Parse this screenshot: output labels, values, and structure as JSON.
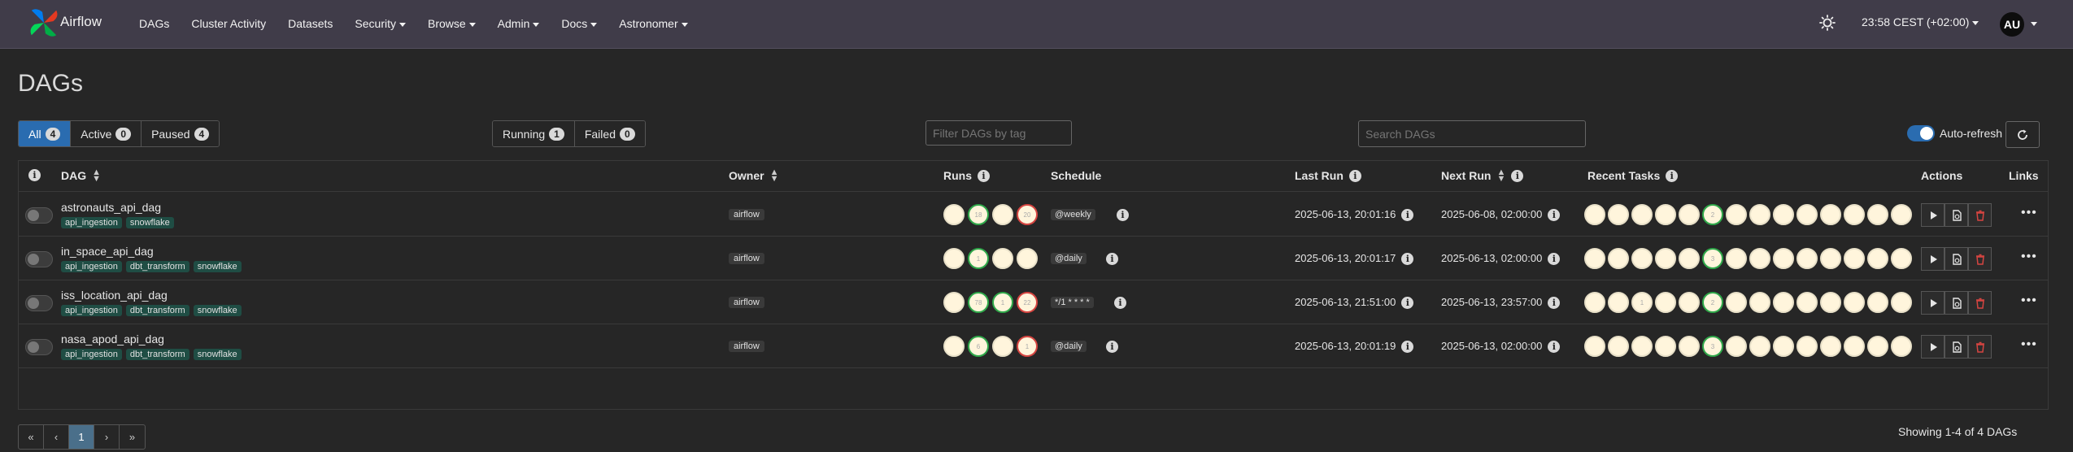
{
  "nav": {
    "brand": "Airflow",
    "items": [
      {
        "label": "DAGs",
        "dropdown": false
      },
      {
        "label": "Cluster Activity",
        "dropdown": false
      },
      {
        "label": "Datasets",
        "dropdown": false
      },
      {
        "label": "Security",
        "dropdown": true
      },
      {
        "label": "Browse",
        "dropdown": true
      },
      {
        "label": "Admin",
        "dropdown": true
      },
      {
        "label": "Docs",
        "dropdown": true
      },
      {
        "label": "Astronomer",
        "dropdown": true
      }
    ],
    "clock": "23:58 CEST (+02:00)",
    "avatar": "AU"
  },
  "page_title": "DAGs",
  "filters": {
    "status_tabs": [
      {
        "label": "All",
        "count": "4",
        "active": true
      },
      {
        "label": "Active",
        "count": "0",
        "active": false
      },
      {
        "label": "Paused",
        "count": "4",
        "active": false
      }
    ],
    "run_tabs": [
      {
        "label": "Running",
        "count": "1"
      },
      {
        "label": "Failed",
        "count": "0"
      }
    ],
    "tag_filter_placeholder": "Filter DAGs by tag",
    "search_placeholder": "Search DAGs",
    "auto_refresh_label": "Auto-refresh",
    "auto_refresh_on": true
  },
  "table": {
    "headers": {
      "dag": "DAG",
      "owner": "Owner",
      "runs": "Runs",
      "schedule": "Schedule",
      "last_run": "Last Run",
      "next_run": "Next Run",
      "recent_tasks": "Recent Tasks",
      "actions": "Actions",
      "links": "Links"
    },
    "rows": [
      {
        "name": "astronauts_api_dag",
        "tags": [
          "api_ingestion",
          "snowflake"
        ],
        "owner": "airflow",
        "runs": [
          {
            "count": "",
            "state": "none"
          },
          {
            "count": "18",
            "state": "success"
          },
          {
            "count": "",
            "state": "none"
          },
          {
            "count": "20",
            "state": "failed"
          }
        ],
        "schedule": "@weekly",
        "last_run": "2025-06-13, 20:01:16",
        "next_run": "2025-06-08, 02:00:00",
        "recent_tasks": [
          {
            "count": "",
            "state": "none"
          },
          {
            "count": "",
            "state": "none"
          },
          {
            "count": "",
            "state": "none"
          },
          {
            "count": "",
            "state": "none"
          },
          {
            "count": "",
            "state": "none"
          },
          {
            "count": "2",
            "state": "success"
          },
          {
            "count": "",
            "state": "none"
          },
          {
            "count": "",
            "state": "none"
          },
          {
            "count": "",
            "state": "none"
          },
          {
            "count": "",
            "state": "none"
          },
          {
            "count": "",
            "state": "none"
          },
          {
            "count": "",
            "state": "none"
          },
          {
            "count": "",
            "state": "none"
          },
          {
            "count": "",
            "state": "none"
          }
        ]
      },
      {
        "name": "in_space_api_dag",
        "tags": [
          "api_ingestion",
          "dbt_transform",
          "snowflake"
        ],
        "owner": "airflow",
        "runs": [
          {
            "count": "",
            "state": "none"
          },
          {
            "count": "1",
            "state": "success"
          },
          {
            "count": "",
            "state": "none"
          },
          {
            "count": "",
            "state": "none"
          }
        ],
        "schedule": "@daily",
        "last_run": "2025-06-13, 20:01:17",
        "next_run": "2025-06-13, 02:00:00",
        "recent_tasks": [
          {
            "count": "",
            "state": "none"
          },
          {
            "count": "",
            "state": "none"
          },
          {
            "count": "",
            "state": "none"
          },
          {
            "count": "",
            "state": "none"
          },
          {
            "count": "",
            "state": "none"
          },
          {
            "count": "3",
            "state": "success"
          },
          {
            "count": "",
            "state": "none"
          },
          {
            "count": "",
            "state": "none"
          },
          {
            "count": "",
            "state": "none"
          },
          {
            "count": "",
            "state": "none"
          },
          {
            "count": "",
            "state": "none"
          },
          {
            "count": "",
            "state": "none"
          },
          {
            "count": "",
            "state": "none"
          },
          {
            "count": "",
            "state": "none"
          }
        ]
      },
      {
        "name": "iss_location_api_dag",
        "tags": [
          "api_ingestion",
          "dbt_transform",
          "snowflake"
        ],
        "owner": "airflow",
        "runs": [
          {
            "count": "",
            "state": "none"
          },
          {
            "count": "78",
            "state": "success"
          },
          {
            "count": "1",
            "state": "success"
          },
          {
            "count": "22",
            "state": "failed"
          }
        ],
        "schedule": "*/1 * * * *",
        "last_run": "2025-06-13, 21:51:00",
        "next_run": "2025-06-13, 23:57:00",
        "recent_tasks": [
          {
            "count": "",
            "state": "none"
          },
          {
            "count": "",
            "state": "none"
          },
          {
            "count": "1",
            "state": "none"
          },
          {
            "count": "",
            "state": "none"
          },
          {
            "count": "",
            "state": "none"
          },
          {
            "count": "2",
            "state": "success"
          },
          {
            "count": "",
            "state": "none"
          },
          {
            "count": "",
            "state": "none"
          },
          {
            "count": "",
            "state": "none"
          },
          {
            "count": "",
            "state": "none"
          },
          {
            "count": "",
            "state": "none"
          },
          {
            "count": "",
            "state": "none"
          },
          {
            "count": "",
            "state": "none"
          },
          {
            "count": "",
            "state": "none"
          }
        ]
      },
      {
        "name": "nasa_apod_api_dag",
        "tags": [
          "api_ingestion",
          "dbt_transform",
          "snowflake"
        ],
        "owner": "airflow",
        "runs": [
          {
            "count": "",
            "state": "none"
          },
          {
            "count": "6",
            "state": "success"
          },
          {
            "count": "",
            "state": "none"
          },
          {
            "count": "1",
            "state": "failed"
          }
        ],
        "schedule": "@daily",
        "last_run": "2025-06-13, 20:01:19",
        "next_run": "2025-06-13, 02:00:00",
        "recent_tasks": [
          {
            "count": "",
            "state": "none"
          },
          {
            "count": "",
            "state": "none"
          },
          {
            "count": "",
            "state": "none"
          },
          {
            "count": "",
            "state": "none"
          },
          {
            "count": "",
            "state": "none"
          },
          {
            "count": "3",
            "state": "success"
          },
          {
            "count": "",
            "state": "none"
          },
          {
            "count": "",
            "state": "none"
          },
          {
            "count": "",
            "state": "none"
          },
          {
            "count": "",
            "state": "none"
          },
          {
            "count": "",
            "state": "none"
          },
          {
            "count": "",
            "state": "none"
          },
          {
            "count": "",
            "state": "none"
          },
          {
            "count": "",
            "state": "none"
          }
        ]
      }
    ]
  },
  "pagination": {
    "pages": [
      "«",
      "‹",
      "1",
      "›",
      "»"
    ],
    "active": "1",
    "showing": "Showing 1-4 of 4 DAGs"
  },
  "icons": {
    "logo": "airflow-pinwheel-icon",
    "theme": "sun-icon",
    "refresh": "refresh-icon",
    "trigger": "play-icon",
    "parse": "file-refresh-icon",
    "delete": "trash-icon",
    "links": "more-dots-icon"
  },
  "colors": {
    "navbar": "#403c49",
    "primary": "#2a6cb0",
    "success": "#2fa84a",
    "failed": "#d64541",
    "tag": "#1f4d44"
  }
}
